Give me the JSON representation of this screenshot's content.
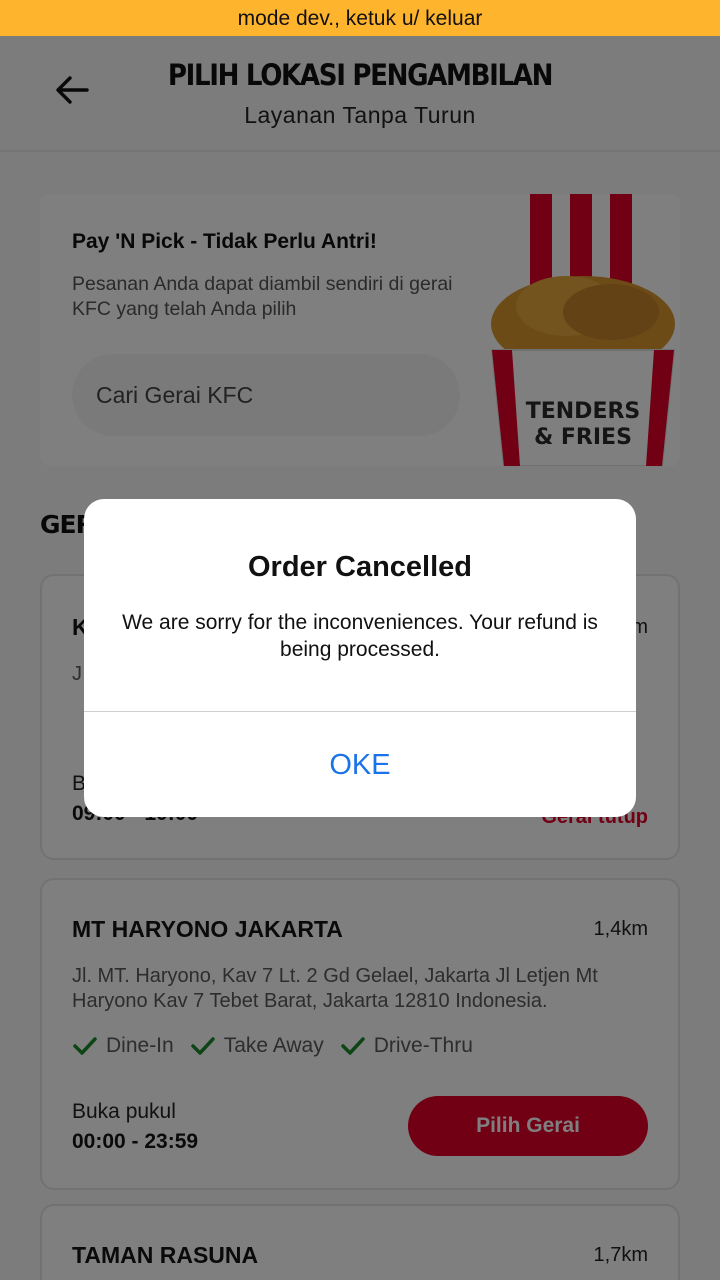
{
  "dev_banner": "mode dev., ketuk u/ keluar",
  "header": {
    "title": "PILIH LOKASI PENGAMBILAN",
    "subtitle": "Layanan Tanpa Turun"
  },
  "promo": {
    "title": "Pay 'N Pick - Tidak Perlu Antri!",
    "description": "Pesanan Anda dapat diambil sendiri di gerai KFC yang telah Anda pilih",
    "search_label": "Cari Gerai KFC",
    "image_caption_1": "TENDERS",
    "image_caption_2": "& FRIES"
  },
  "section_title_partial": "GER",
  "stores": [
    {
      "name_partial": "K",
      "distance_partial": "m",
      "address_partial": "J",
      "hours_label_partial": "B",
      "hours_partial": "09:00 - 10:00",
      "status": "Gerai tutup"
    },
    {
      "name": "MT HARYONO JAKARTA",
      "distance": "1,4km",
      "address": "Jl. MT. Haryono, Kav 7 Lt. 2 Gd Gelael, Jakarta Jl Letjen Mt Haryono Kav 7 Tebet Barat, Jakarta 12810 Indonesia.",
      "services": [
        "Dine-In",
        "Take Away",
        "Drive-Thru"
      ],
      "hours_label": "Buka pukul",
      "hours": "00:00 - 23:59",
      "button": "Pilih Gerai"
    },
    {
      "name": "TAMAN RASUNA",
      "distance": "1,7km"
    }
  ],
  "dialog": {
    "title": "Order Cancelled",
    "message": "We are sorry for the inconveniences. Your refund is being processed.",
    "ok_label": "OKE"
  },
  "colors": {
    "brand_red": "#e4002b",
    "dev_banner": "#ffb42e",
    "link_blue": "#1a73e8",
    "check_green": "#1a8a2a"
  }
}
